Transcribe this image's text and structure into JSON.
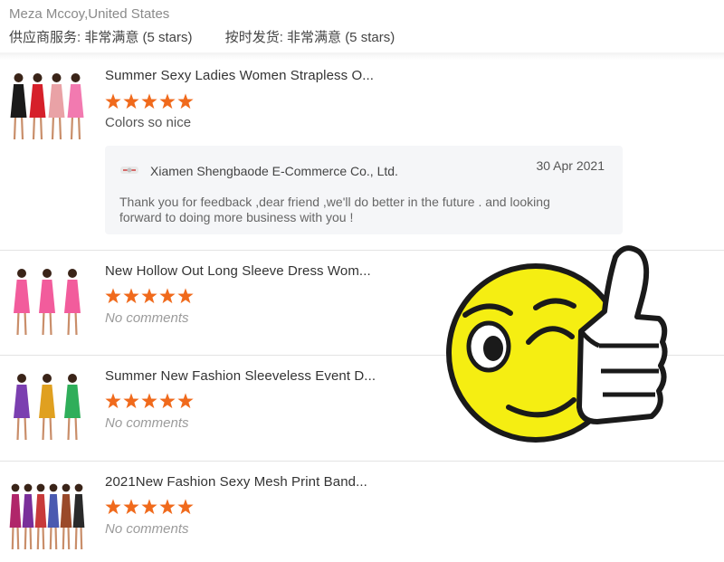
{
  "reviewer": {
    "name": "Meza Mccoy",
    "country": "United States",
    "full": "Meza Mccoy,United States"
  },
  "ratings": {
    "supplier_service": "供应商服务: 非常满意 (5 stars)",
    "on_time": "按时发货: 非常满意 (5 stars)"
  },
  "colors": {
    "star": "#f06a1c",
    "emoji_yellow": "#f5ee12",
    "reply_bg": "#f5f6f8"
  },
  "reviews": [
    {
      "title": "Summer Sexy Ladies Women Strapless O...",
      "rating": 5,
      "comment": "Colors so nice",
      "thumb_colors": [
        "#1a1a1a",
        "#d6202a",
        "#e9a2a6",
        "#f27ab0"
      ],
      "reply": {
        "seller": "Xiamen Shengbaode E-Commerce Co., Ltd.",
        "date": "30 Apr 2021",
        "text": "Thank you for feedback ,dear friend ,we'll do better in the future . and  looking forward to doing more business with you !"
      }
    },
    {
      "title": "New Hollow Out Long Sleeve Dress Wom...",
      "rating": 5,
      "comment": "No comments",
      "thumb_colors": [
        "#f25c9c",
        "#f25c9c",
        "#f25c9c"
      ]
    },
    {
      "title": "Summer New Fashion Sleeveless Event D...",
      "rating": 5,
      "comment": "No comments",
      "thumb_colors": [
        "#7b3fb0",
        "#e0a020",
        "#2fae5a"
      ]
    },
    {
      "title": "2021New Fashion Sexy Mesh Print Band...",
      "rating": 5,
      "comment": "No comments",
      "thumb_colors": [
        "#b0266a",
        "#7a2f9a",
        "#c83a3a",
        "#4a5ab0",
        "#9a4a2a",
        "#2a2a2a"
      ]
    }
  ]
}
